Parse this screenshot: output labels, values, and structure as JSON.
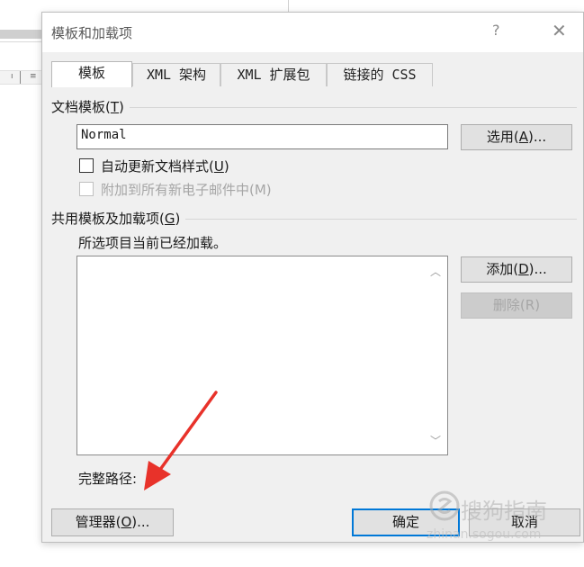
{
  "dialog": {
    "title": "模板和加载项",
    "help_glyph": "?",
    "close_glyph": "✕"
  },
  "tabs": [
    {
      "label": "模板"
    },
    {
      "label": "XML 架构"
    },
    {
      "label": "XML 扩展包"
    },
    {
      "label": "链接的 CSS"
    }
  ],
  "document_template": {
    "group_label": "文档模板(",
    "group_label_key": "T",
    "group_label_end": ")",
    "template_value": "Normal",
    "select_button": "选用(",
    "select_button_key": "A",
    "select_button_end": ")...",
    "auto_update_label": "自动更新文档样式(",
    "auto_update_key": "U",
    "auto_update_end": ")",
    "attach_email_label": "附加到所有新电子邮件中(M)"
  },
  "global_templates": {
    "group_label": "共用模板及加载项(",
    "group_label_key": "G",
    "group_label_end": ")",
    "status_text": "所选项目当前已经加载。",
    "add_button": "添加(",
    "add_button_key": "D",
    "add_button_end": ")...",
    "remove_button": "删除(R)",
    "full_path_label": "完整路径:"
  },
  "footer": {
    "organizer_button": "管理器(",
    "organizer_button_key": "O",
    "organizer_button_end": ")...",
    "ok_button": "确定",
    "cancel_button": "取消"
  },
  "watermark": {
    "brand": "搜狗指南",
    "url": "zhinan.sogou.com"
  },
  "colors": {
    "annotation_arrow": "#e8322a",
    "dialog_bg": "#f0f0f0",
    "default_button_border": "#0078d7"
  }
}
